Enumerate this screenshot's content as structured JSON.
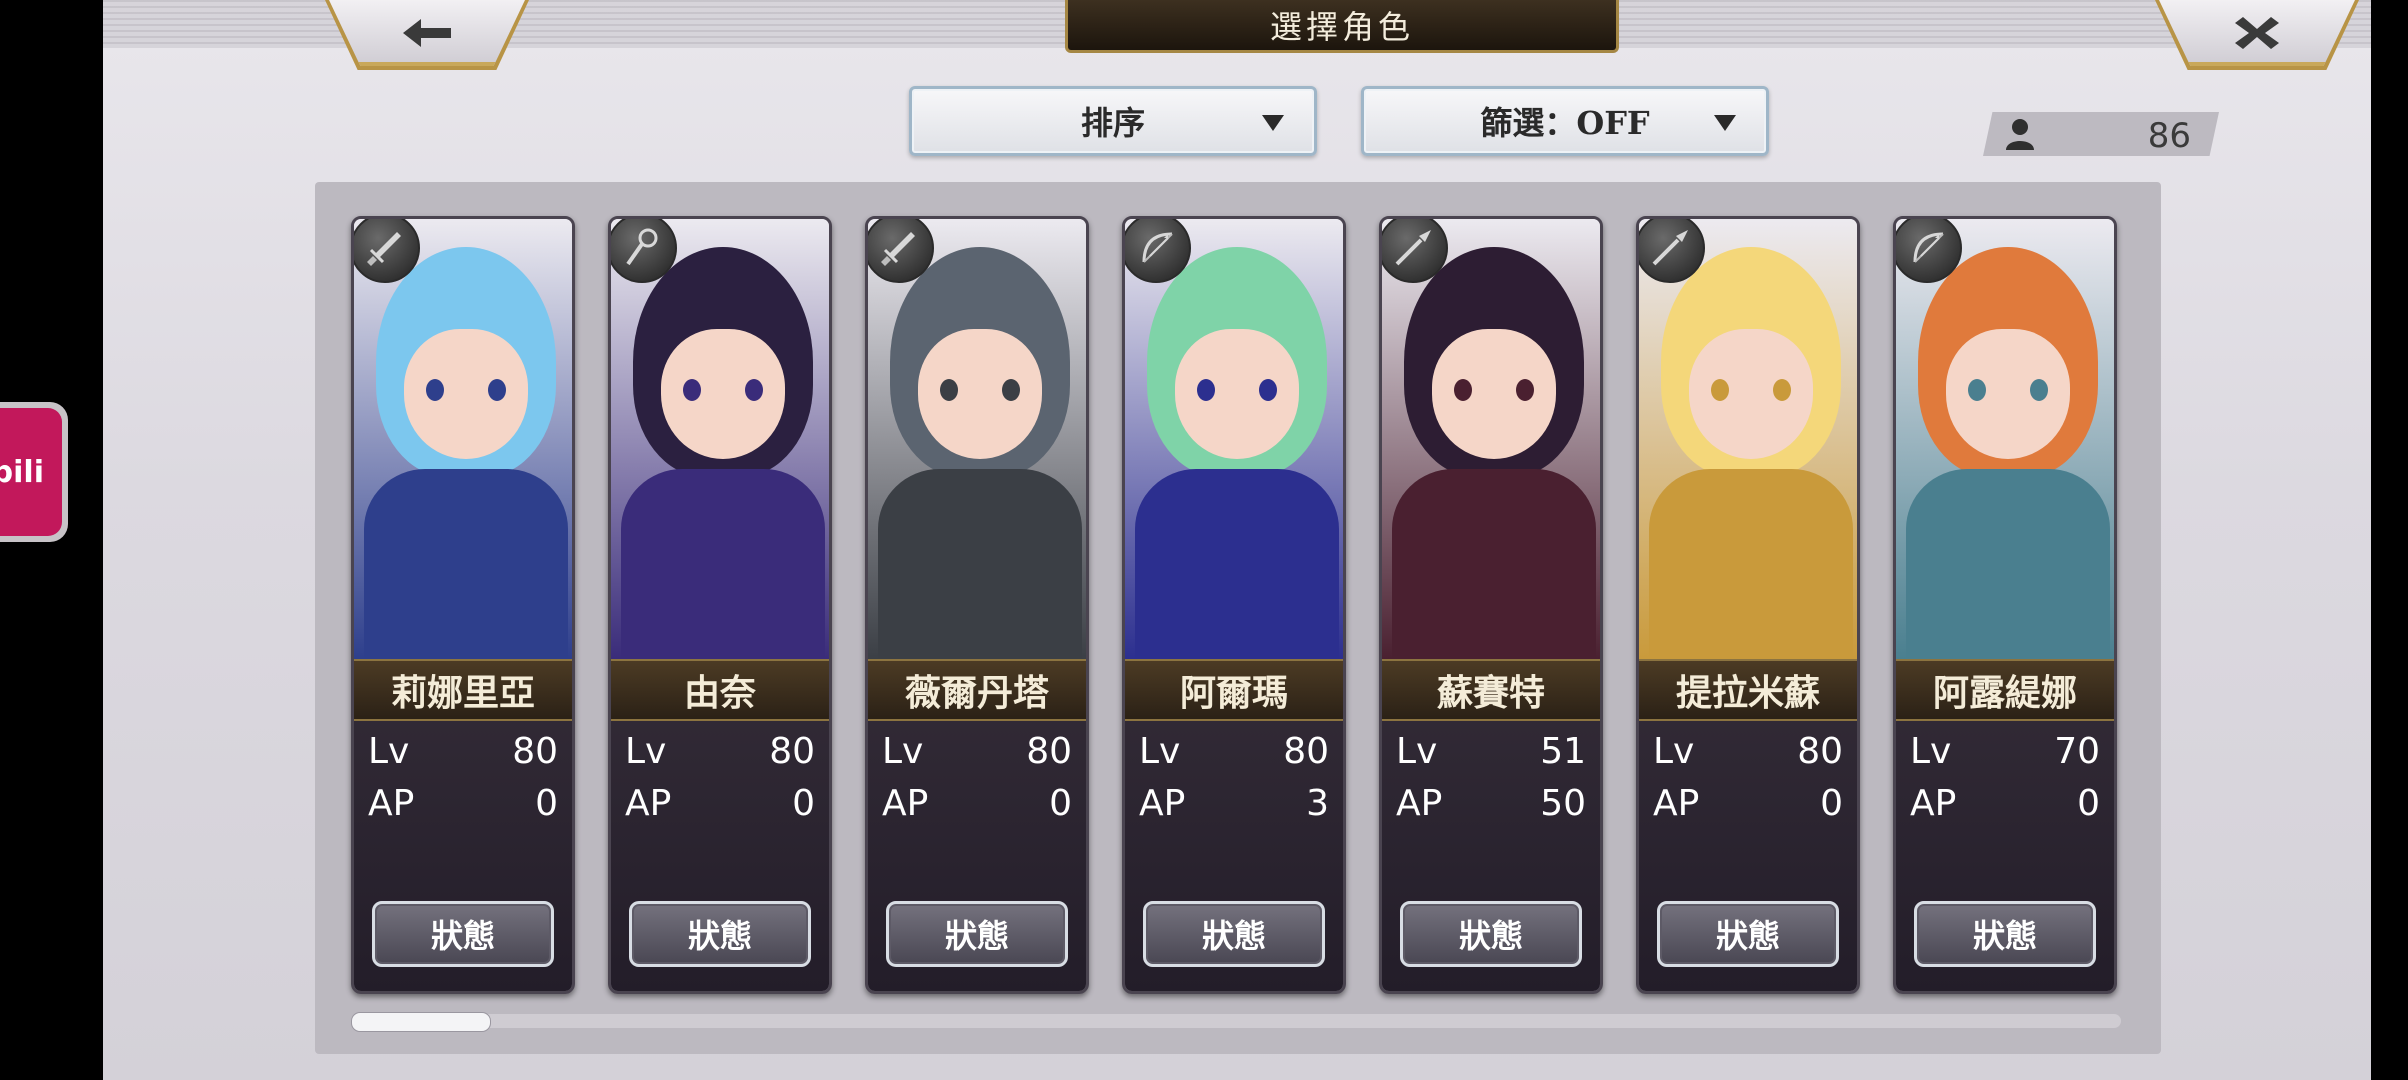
{
  "header": {
    "title": "選擇角色",
    "back_icon": "arrow-left-icon",
    "close_icon": "close-x-icon"
  },
  "side_app": {
    "label": "bili"
  },
  "controls": {
    "sort_label": "排序",
    "filter_label": "篩選：OFF"
  },
  "roster_count": "86",
  "characters": [
    {
      "name": "莉娜里亞",
      "lv_label": "Lv",
      "lv": "80",
      "ap_label": "AP",
      "ap": "0",
      "status": "狀態",
      "class_icon": "sword-icon",
      "hair": "#7cc7ee",
      "accent": "#2e3f8c"
    },
    {
      "name": "由奈",
      "lv_label": "Lv",
      "lv": "80",
      "ap_label": "AP",
      "ap": "0",
      "status": "狀態",
      "class_icon": "staff-icon",
      "hair": "#2b2040",
      "accent": "#3a2c7a"
    },
    {
      "name": "薇爾丹塔",
      "lv_label": "Lv",
      "lv": "80",
      "ap_label": "AP",
      "ap": "0",
      "status": "狀態",
      "class_icon": "sword-icon",
      "hair": "#5b6470",
      "accent": "#3b3f45"
    },
    {
      "name": "阿爾瑪",
      "lv_label": "Lv",
      "lv": "80",
      "ap_label": "AP",
      "ap": "3",
      "status": "狀態",
      "class_icon": "bow-icon",
      "hair": "#7fd3a8",
      "accent": "#2c2f8f"
    },
    {
      "name": "蘇賽特",
      "lv_label": "Lv",
      "lv": "51",
      "ap_label": "AP",
      "ap": "50",
      "status": "狀態",
      "class_icon": "spear-icon",
      "hair": "#2d1d33",
      "accent": "#4a2030"
    },
    {
      "name": "提拉米蘇",
      "lv_label": "Lv",
      "lv": "80",
      "ap_label": "AP",
      "ap": "0",
      "status": "狀態",
      "class_icon": "spear-icon",
      "hair": "#f4d77a",
      "accent": "#c99a3b"
    },
    {
      "name": "阿露緹娜",
      "lv_label": "Lv",
      "lv": "70",
      "ap_label": "AP",
      "ap": "0",
      "status": "狀態",
      "class_icon": "bow-icon",
      "hair": "#e07a3c",
      "accent": "#4a7f8f"
    }
  ],
  "colors": {
    "gold_trim": "#a58744",
    "panel": "#bcb9c0",
    "bili_pink": "#c2185b"
  }
}
